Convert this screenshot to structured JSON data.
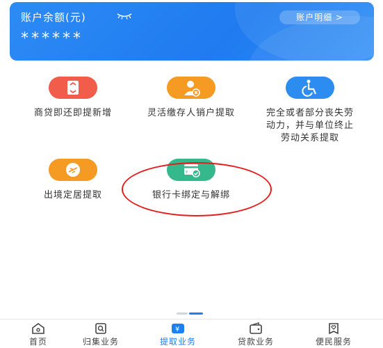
{
  "account": {
    "balance_title": "账户余额(元)",
    "balance_masked": "******",
    "detail_button": "账户明细 >"
  },
  "services": [
    {
      "label": "商贷即还即提新增",
      "icon": "loan-repay-icon",
      "color": "#f25c4a"
    },
    {
      "label": "灵活缴存人销户提取",
      "icon": "person-cancel-icon",
      "color": "#f59a23"
    },
    {
      "label": "完全或者部分丧失劳动力，并与单位终止劳动关系提取",
      "icon": "wheelchair-icon",
      "color": "#2d8cf0"
    },
    {
      "label": "出境定居提取",
      "icon": "airplane-icon",
      "color": "#f59a23"
    },
    {
      "label": "银行卡绑定与解绑",
      "icon": "bank-card-icon",
      "color": "#35b98c"
    }
  ],
  "tabs": [
    {
      "label": "首页",
      "icon": "home-icon",
      "active": false
    },
    {
      "label": "归集业务",
      "icon": "search-doc-icon",
      "active": false
    },
    {
      "label": "提取业务",
      "icon": "yuan-withdraw-icon",
      "active": true
    },
    {
      "label": "贷款业务",
      "icon": "wallet-icon",
      "active": false
    },
    {
      "label": "便民服务",
      "icon": "heart-service-icon",
      "active": false
    }
  ],
  "colors": {
    "accent": "#1e7ff2",
    "highlight_circle": "#e41e1e"
  }
}
